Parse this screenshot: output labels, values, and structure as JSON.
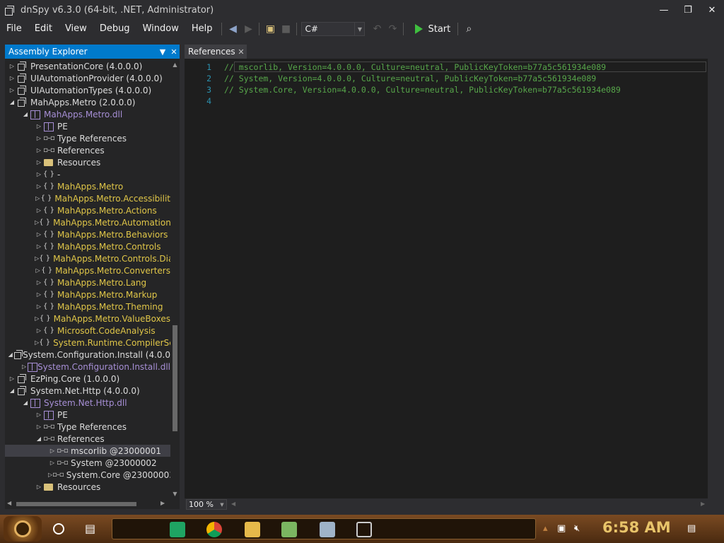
{
  "window": {
    "title": "dnSpy v6.3.0 (64-bit, .NET, Administrator)",
    "minimize": "—",
    "restore": "❐",
    "close": "✕"
  },
  "menu": [
    "File",
    "Edit",
    "View",
    "Debug",
    "Window",
    "Help"
  ],
  "toolbar": {
    "language": "C#",
    "start_label": "Start"
  },
  "explorer": {
    "title": "Assembly Explorer",
    "rows": [
      {
        "indent": 0,
        "exp": "▷",
        "icon": "asm",
        "text": "PresentationCore (4.0.0.0)",
        "style": "gray"
      },
      {
        "indent": 0,
        "exp": "▷",
        "icon": "asm",
        "text": "UIAutomationProvider (4.0.0.0)",
        "style": "gray"
      },
      {
        "indent": 0,
        "exp": "▷",
        "icon": "asm",
        "text": "UIAutomationTypes (4.0.0.0)",
        "style": "gray"
      },
      {
        "indent": 0,
        "exp": "◢",
        "icon": "asm",
        "text": "MahApps.Metro (2.0.0.0)",
        "style": "gray"
      },
      {
        "indent": 1,
        "exp": "◢",
        "icon": "mod",
        "text": "MahApps.Metro.dll",
        "style": "mod"
      },
      {
        "indent": 2,
        "exp": "▷",
        "icon": "mod",
        "text": "PE",
        "style": "gray"
      },
      {
        "indent": 2,
        "exp": "▷",
        "icon": "ref",
        "text": "Type References",
        "style": "gray"
      },
      {
        "indent": 2,
        "exp": "▷",
        "icon": "ref",
        "text": "References",
        "style": "gray"
      },
      {
        "indent": 2,
        "exp": "▷",
        "icon": "folder",
        "text": "Resources",
        "style": "gray"
      },
      {
        "indent": 2,
        "exp": "▷",
        "icon": "ns",
        "text": "-",
        "style": "gray"
      },
      {
        "indent": 2,
        "exp": "▷",
        "icon": "ns",
        "text": "MahApps.Metro",
        "style": "ns"
      },
      {
        "indent": 2,
        "exp": "▷",
        "icon": "ns",
        "text": "MahApps.Metro.Accessibilit",
        "style": "ns"
      },
      {
        "indent": 2,
        "exp": "▷",
        "icon": "ns",
        "text": "MahApps.Metro.Actions",
        "style": "ns"
      },
      {
        "indent": 2,
        "exp": "▷",
        "icon": "ns",
        "text": "MahApps.Metro.Automation.",
        "style": "ns"
      },
      {
        "indent": 2,
        "exp": "▷",
        "icon": "ns",
        "text": "MahApps.Metro.Behaviors",
        "style": "ns"
      },
      {
        "indent": 2,
        "exp": "▷",
        "icon": "ns",
        "text": "MahApps.Metro.Controls",
        "style": "ns"
      },
      {
        "indent": 2,
        "exp": "▷",
        "icon": "ns",
        "text": "MahApps.Metro.Controls.Dia",
        "style": "ns"
      },
      {
        "indent": 2,
        "exp": "▷",
        "icon": "ns",
        "text": "MahApps.Metro.Converters",
        "style": "ns"
      },
      {
        "indent": 2,
        "exp": "▷",
        "icon": "ns",
        "text": "MahApps.Metro.Lang",
        "style": "ns"
      },
      {
        "indent": 2,
        "exp": "▷",
        "icon": "ns",
        "text": "MahApps.Metro.Markup",
        "style": "ns"
      },
      {
        "indent": 2,
        "exp": "▷",
        "icon": "ns",
        "text": "MahApps.Metro.Theming",
        "style": "ns"
      },
      {
        "indent": 2,
        "exp": "▷",
        "icon": "ns",
        "text": "MahApps.Metro.ValueBoxes",
        "style": "ns"
      },
      {
        "indent": 2,
        "exp": "▷",
        "icon": "ns",
        "text": "Microsoft.CodeAnalysis",
        "style": "ns"
      },
      {
        "indent": 2,
        "exp": "▷",
        "icon": "ns",
        "text": "System.Runtime.CompilerSer",
        "style": "ns"
      },
      {
        "indent": 0,
        "exp": "◢",
        "icon": "asm",
        "text": "System.Configuration.Install (4.0.0",
        "style": "gray"
      },
      {
        "indent": 1,
        "exp": "▷",
        "icon": "mod",
        "text": "System.Configuration.Install.dll",
        "style": "mod"
      },
      {
        "indent": 0,
        "exp": "▷",
        "icon": "asm",
        "text": "EzPing.Core (1.0.0.0)",
        "style": "gray"
      },
      {
        "indent": 0,
        "exp": "◢",
        "icon": "asm",
        "text": "System.Net.Http (4.0.0.0)",
        "style": "gray"
      },
      {
        "indent": 1,
        "exp": "◢",
        "icon": "mod",
        "text": "System.Net.Http.dll",
        "style": "mod"
      },
      {
        "indent": 2,
        "exp": "▷",
        "icon": "mod",
        "text": "PE",
        "style": "gray"
      },
      {
        "indent": 2,
        "exp": "▷",
        "icon": "ref",
        "text": "Type References",
        "style": "gray"
      },
      {
        "indent": 2,
        "exp": "◢",
        "icon": "ref",
        "text": "References",
        "style": "gray"
      },
      {
        "indent": 3,
        "exp": "▷",
        "icon": "ref",
        "text": "mscorlib @23000001",
        "style": "gray",
        "selected": true
      },
      {
        "indent": 3,
        "exp": "▷",
        "icon": "ref",
        "text": "System @23000002",
        "style": "gray"
      },
      {
        "indent": 3,
        "exp": "▷",
        "icon": "ref",
        "text": "System.Core @23000003",
        "style": "gray"
      },
      {
        "indent": 2,
        "exp": "▷",
        "icon": "folder",
        "text": "Resources",
        "style": "gray"
      }
    ]
  },
  "editor": {
    "tab_label": "References",
    "lines": [
      {
        "n": "1",
        "code": "// mscorlib, Version=4.0.0.0, Culture=neutral, PublicKeyToken=b77a5c561934e089"
      },
      {
        "n": "2",
        "code": "// System, Version=4.0.0.0, Culture=neutral, PublicKeyToken=b77a5c561934e089"
      },
      {
        "n": "3",
        "code": "// System.Core, Version=4.0.0.0, Culture=neutral, PublicKeyToken=b77a5c561934e089"
      },
      {
        "n": "4",
        "code": ""
      }
    ],
    "zoom": "100 %"
  },
  "taskbar": {
    "time": "6:58 AM"
  },
  "colors": {
    "accent": "#007acc",
    "comment": "#57a64a",
    "line_number": "#2b91af",
    "namespace": "#e0c648",
    "module": "#a78fd6"
  }
}
